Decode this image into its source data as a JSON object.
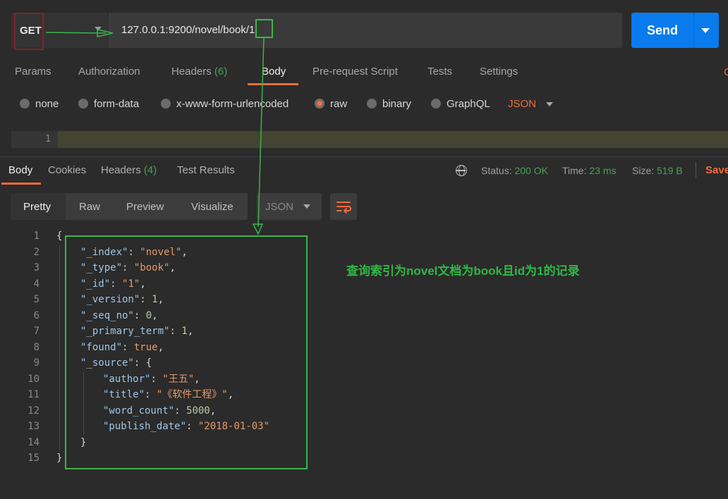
{
  "request": {
    "method": "GET",
    "url": "127.0.0.1:9200/novel/book/1",
    "send_label": "Send"
  },
  "request_tabs": {
    "params": "Params",
    "authorization": "Authorization",
    "headers": "Headers",
    "headers_count": "(6)",
    "body": "Body",
    "prerequest": "Pre-request Script",
    "tests": "Tests",
    "settings": "Settings"
  },
  "body_types": {
    "none": "none",
    "form_data": "form-data",
    "urlencoded": "x-www-form-urlencoded",
    "raw": "raw",
    "binary": "binary",
    "graphql": "GraphQL",
    "selected": "raw",
    "format": "JSON"
  },
  "request_editor": {
    "line_number": "1"
  },
  "response_tabs": {
    "body": "Body",
    "cookies": "Cookies",
    "headers": "Headers",
    "headers_count": "(4)",
    "test_results": "Test Results"
  },
  "status": {
    "status_label": "Status:",
    "status_value": "200 OK",
    "time_label": "Time:",
    "time_value": "23 ms",
    "size_label": "Size:",
    "size_value": "519 B",
    "save_label": "Save"
  },
  "view_modes": {
    "pretty": "Pretty",
    "raw": "Raw",
    "preview": "Preview",
    "visualize": "Visualize",
    "format": "JSON"
  },
  "response_json": {
    "lines": [
      {
        "n": "1",
        "open": "{"
      },
      {
        "n": "2",
        "key": "\"_index\"",
        "value": "\"novel\"",
        "vtype": "str",
        "comma": true
      },
      {
        "n": "3",
        "key": "\"_type\"",
        "value": "\"book\"",
        "vtype": "str",
        "comma": true
      },
      {
        "n": "4",
        "key": "\"_id\"",
        "value": "\"1\"",
        "vtype": "str",
        "comma": true
      },
      {
        "n": "5",
        "key": "\"_version\"",
        "value": "1",
        "vtype": "num",
        "comma": true
      },
      {
        "n": "6",
        "key": "\"_seq_no\"",
        "value": "0",
        "vtype": "num",
        "comma": true
      },
      {
        "n": "7",
        "key": "\"_primary_term\"",
        "value": "1",
        "vtype": "num",
        "comma": true
      },
      {
        "n": "8",
        "key": "\"found\"",
        "value": "true",
        "vtype": "bool",
        "comma": true
      },
      {
        "n": "9",
        "key": "\"_source\"",
        "value": "{",
        "vtype": "brace",
        "comma": false
      },
      {
        "n": "10",
        "key": "\"author\"",
        "value": "\"王五\"",
        "vtype": "str",
        "comma": true,
        "nested": true
      },
      {
        "n": "11",
        "key": "\"title\"",
        "value": "\"《软件工程》\"",
        "vtype": "str",
        "comma": true,
        "nested": true
      },
      {
        "n": "12",
        "key": "\"word_count\"",
        "value": "5000",
        "vtype": "num",
        "comma": true,
        "nested": true
      },
      {
        "n": "13",
        "key": "\"publish_date\"",
        "value": "\"2018-01-03\"",
        "vtype": "str",
        "comma": false,
        "nested": true
      },
      {
        "n": "14",
        "close_inner": "}"
      },
      {
        "n": "15",
        "close": "}"
      }
    ]
  },
  "annotation": {
    "text": "查询索引为novel文档为book且id为1的记录",
    "colors": {
      "green": "#3bb54a",
      "red": "#8a1f2a"
    }
  },
  "theme": {
    "accent": "#f26b3a",
    "send_blue": "#097bed",
    "status_green": "#47a25a",
    "background": "#2b2b2b"
  }
}
